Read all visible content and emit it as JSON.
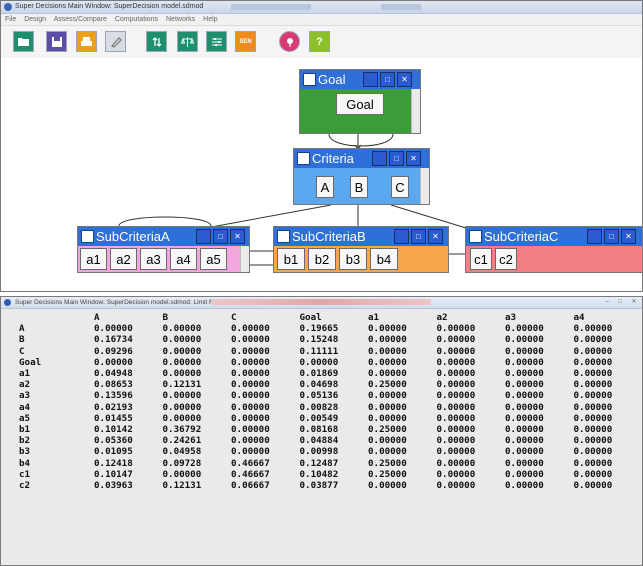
{
  "top_window": {
    "title": "Super Decisions Main Window: SuperDecision model.sdmod",
    "menu": [
      "File",
      "Design",
      "Assess/Compare",
      "Computations",
      "Networks",
      "Help"
    ],
    "toolbar_icons": [
      "open-folder-icon",
      "save-icon",
      "print-icon",
      "edit-icon",
      "refresh-icon",
      "balance-icon",
      "sliders-icon",
      "sen-icon",
      "pin-icon",
      "help-icon"
    ],
    "sen_label": "SEN",
    "help_label": "?",
    "clusters": {
      "goal": {
        "title": "Goal",
        "nodes": [
          "Goal"
        ],
        "color": "#3b9d3a"
      },
      "criteria": {
        "title": "Criteria",
        "nodes": [
          "A",
          "B",
          "C"
        ],
        "color": "#5aa9f0"
      },
      "subA": {
        "title": "SubCriteriaA",
        "nodes": [
          "a1",
          "a2",
          "a3",
          "a4",
          "a5"
        ],
        "color": "#f3a6de"
      },
      "subB": {
        "title": "SubCriteriaB",
        "nodes": [
          "b1",
          "b2",
          "b3",
          "b4"
        ],
        "color": "#f7a64a"
      },
      "subC": {
        "title": "SubCriteriaC",
        "nodes": [
          "c1",
          "c2"
        ],
        "color": "#f17f85"
      }
    }
  },
  "bottom_window": {
    "title": "Super Decisions Main Window: SuperDecision model.sdmod: Limit Matrix",
    "columns": [
      "A",
      "B",
      "C",
      "Goal",
      "a1",
      "a2",
      "a3",
      "a4"
    ],
    "rows": [
      {
        "label": "A",
        "values": [
          "0.00000",
          "0.00000",
          "0.00000",
          "0.19665",
          "0.00000",
          "0.00000",
          "0.00000",
          "0.00000"
        ]
      },
      {
        "label": "B",
        "values": [
          "0.16734",
          "0.00000",
          "0.00000",
          "0.15248",
          "0.00000",
          "0.00000",
          "0.00000",
          "0.00000"
        ]
      },
      {
        "label": "C",
        "values": [
          "0.09296",
          "0.00000",
          "0.00000",
          "0.11111",
          "0.00000",
          "0.00000",
          "0.00000",
          "0.00000"
        ]
      },
      {
        "label": "Goal",
        "values": [
          "0.00000",
          "0.00000",
          "0.00000",
          "0.00000",
          "0.00000",
          "0.00000",
          "0.00000",
          "0.00000"
        ]
      },
      {
        "label": "a1",
        "values": [
          "0.04948",
          "0.00000",
          "0.00000",
          "0.01869",
          "0.00000",
          "0.00000",
          "0.00000",
          "0.00000"
        ]
      },
      {
        "label": "a2",
        "values": [
          "0.08653",
          "0.12131",
          "0.00000",
          "0.04698",
          "0.25000",
          "0.00000",
          "0.00000",
          "0.00000"
        ]
      },
      {
        "label": "a3",
        "values": [
          "0.13596",
          "0.00000",
          "0.00000",
          "0.05136",
          "0.00000",
          "0.00000",
          "0.00000",
          "0.00000"
        ]
      },
      {
        "label": "a4",
        "values": [
          "0.02193",
          "0.00000",
          "0.00000",
          "0.00828",
          "0.00000",
          "0.00000",
          "0.00000",
          "0.00000"
        ]
      },
      {
        "label": "a5",
        "values": [
          "0.01455",
          "0.00000",
          "0.00000",
          "0.00549",
          "0.00000",
          "0.00000",
          "0.00000",
          "0.00000"
        ]
      },
      {
        "label": "b1",
        "values": [
          "0.10142",
          "0.36792",
          "0.00000",
          "0.08168",
          "0.25000",
          "0.00000",
          "0.00000",
          "0.00000"
        ]
      },
      {
        "label": "b2",
        "values": [
          "0.05360",
          "0.24261",
          "0.00000",
          "0.04884",
          "0.00000",
          "0.00000",
          "0.00000",
          "0.00000"
        ]
      },
      {
        "label": "b3",
        "values": [
          "0.01095",
          "0.04958",
          "0.00000",
          "0.00998",
          "0.00000",
          "0.00000",
          "0.00000",
          "0.00000"
        ]
      },
      {
        "label": "b4",
        "values": [
          "0.12418",
          "0.09728",
          "0.46667",
          "0.12487",
          "0.25000",
          "0.00000",
          "0.00000",
          "0.00000"
        ]
      },
      {
        "label": "c1",
        "values": [
          "0.10147",
          "0.00000",
          "0.46667",
          "0.10482",
          "0.25000",
          "0.00000",
          "0.00000",
          "0.00000"
        ]
      },
      {
        "label": "c2",
        "values": [
          "0.03963",
          "0.12131",
          "0.06667",
          "0.03877",
          "0.00000",
          "0.00000",
          "0.00000",
          "0.00000"
        ]
      }
    ]
  }
}
